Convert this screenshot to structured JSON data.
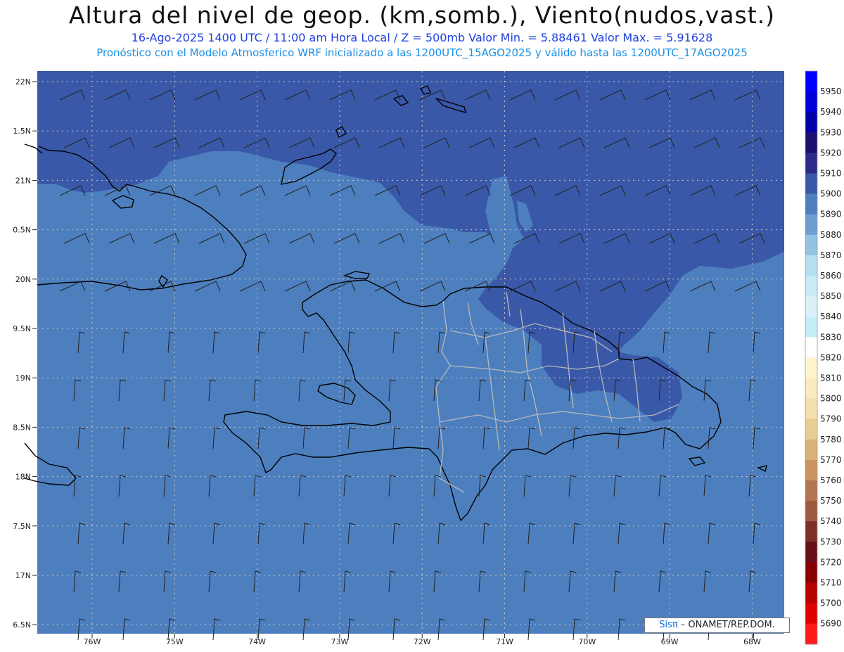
{
  "header": {
    "title": "Altura del nivel de geop. (km,somb.), Viento(nudos,vast.)",
    "subtitle": "16-Ago-2025  1400 UTC / 11:00 am Hora Local / Z = 500mb    Valor Min. = 5.88461   Valor Max. = 5.91628",
    "model_info": "Pronóstico con el Modelo Atmosferico WRF inicializado a las 1200UTC_15AGO2025 y válido hasta las  1200UTC_17AGO2025"
  },
  "map": {
    "lat_labels": [
      "22N",
      "1.5N",
      "21N",
      "0.5N",
      "20N",
      "9.5N",
      "19N",
      "8.5N",
      "18N",
      "7.5N",
      "17N",
      "6.5N"
    ],
    "lon_labels": [
      "76W",
      "75W",
      "74W",
      "73W",
      "72W",
      "71W",
      "70W",
      "69W",
      "68W"
    ],
    "colors": {
      "field_5890": "#4d7fbe",
      "field_5900": "#3a58a8",
      "coastline": "#000000",
      "provinces": "#b9b9b9",
      "grid": "#c8c8c8"
    }
  },
  "colorbar": {
    "levels": [
      "5950",
      "5940",
      "5930",
      "5920",
      "5910",
      "5900",
      "5890",
      "5880",
      "5870",
      "5860",
      "5850",
      "5840",
      "5830",
      "5820",
      "5810",
      "5800",
      "5790",
      "5780",
      "5770",
      "5760",
      "5750",
      "5740",
      "5730",
      "5720",
      "5710",
      "5700",
      "5690"
    ],
    "colors": [
      "#0000ff",
      "#0000d8",
      "#0000a8",
      "#1c1070",
      "#2c2a8a",
      "#3a58a8",
      "#4d7fbe",
      "#6f9fd2",
      "#93c3e3",
      "#b5dff0",
      "#c8eaf5",
      "#dbf1fa",
      "#c6ecf7",
      "#ffffff",
      "#fff4cc",
      "#f9ebc0",
      "#f2dfac",
      "#e8cd92",
      "#dab278",
      "#c99460",
      "#b37650",
      "#9c5a3e",
      "#7d2f28",
      "#68101a",
      "#8a0000",
      "#b80000",
      "#e00000",
      "#ff1a1a"
    ]
  },
  "credit": {
    "brand": "Sisπ",
    "text": " – ONAMET/REP.DOM."
  }
}
